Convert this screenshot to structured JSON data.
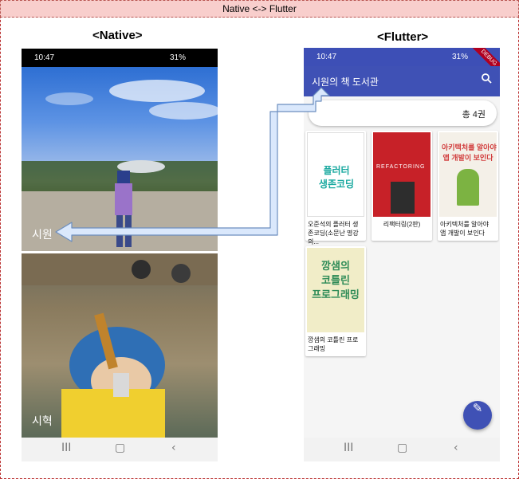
{
  "diagram": {
    "title": "Native <-> Flutter"
  },
  "native": {
    "label": "<Native>",
    "status_time": "10:47",
    "status_right": "31%",
    "photos": [
      {
        "caption": "시원"
      },
      {
        "caption": "시혁"
      }
    ],
    "nav": {
      "recent": "III",
      "home": "▢",
      "back": "‹"
    }
  },
  "flutter": {
    "label": "<Flutter>",
    "status_time": "10:47",
    "status_right": "31%",
    "appbar_title": "시원의 책 도서관",
    "debug_banner": "DEBUG",
    "count_text": "총 4권",
    "books": [
      {
        "title": "오준석의 플러터 생존코딩(소문난 명강의...",
        "cover_text": "플러터\n생존코딩",
        "cover_color": "#ffffff",
        "text_color": "#1aa9a0"
      },
      {
        "title": "리팩터링(2판)",
        "cover_text": "REFACTORING",
        "cover_color": "#c72128",
        "text_color": "#ffffff"
      },
      {
        "title": "아키텍처를 알아야 앱 개발이 보인다",
        "cover_text": "아키텍처를 알아야\n앱 개발이 보인다",
        "cover_color": "#f4f0e8",
        "text_color": "#d13b3b"
      },
      {
        "title": "깡샘의 코틀린 프로그래밍",
        "cover_text": "깡샘의\n코틀린\n프로그래밍",
        "cover_color": "#f1edc8",
        "text_color": "#2e8b57"
      }
    ],
    "fab_icon": "edit-icon",
    "nav": {
      "recent": "III",
      "home": "▢",
      "back": "‹"
    }
  },
  "colors": {
    "primary": "#3f51b5",
    "arrow_fill": "#dae8fc",
    "arrow_stroke": "#6c8ebf"
  }
}
